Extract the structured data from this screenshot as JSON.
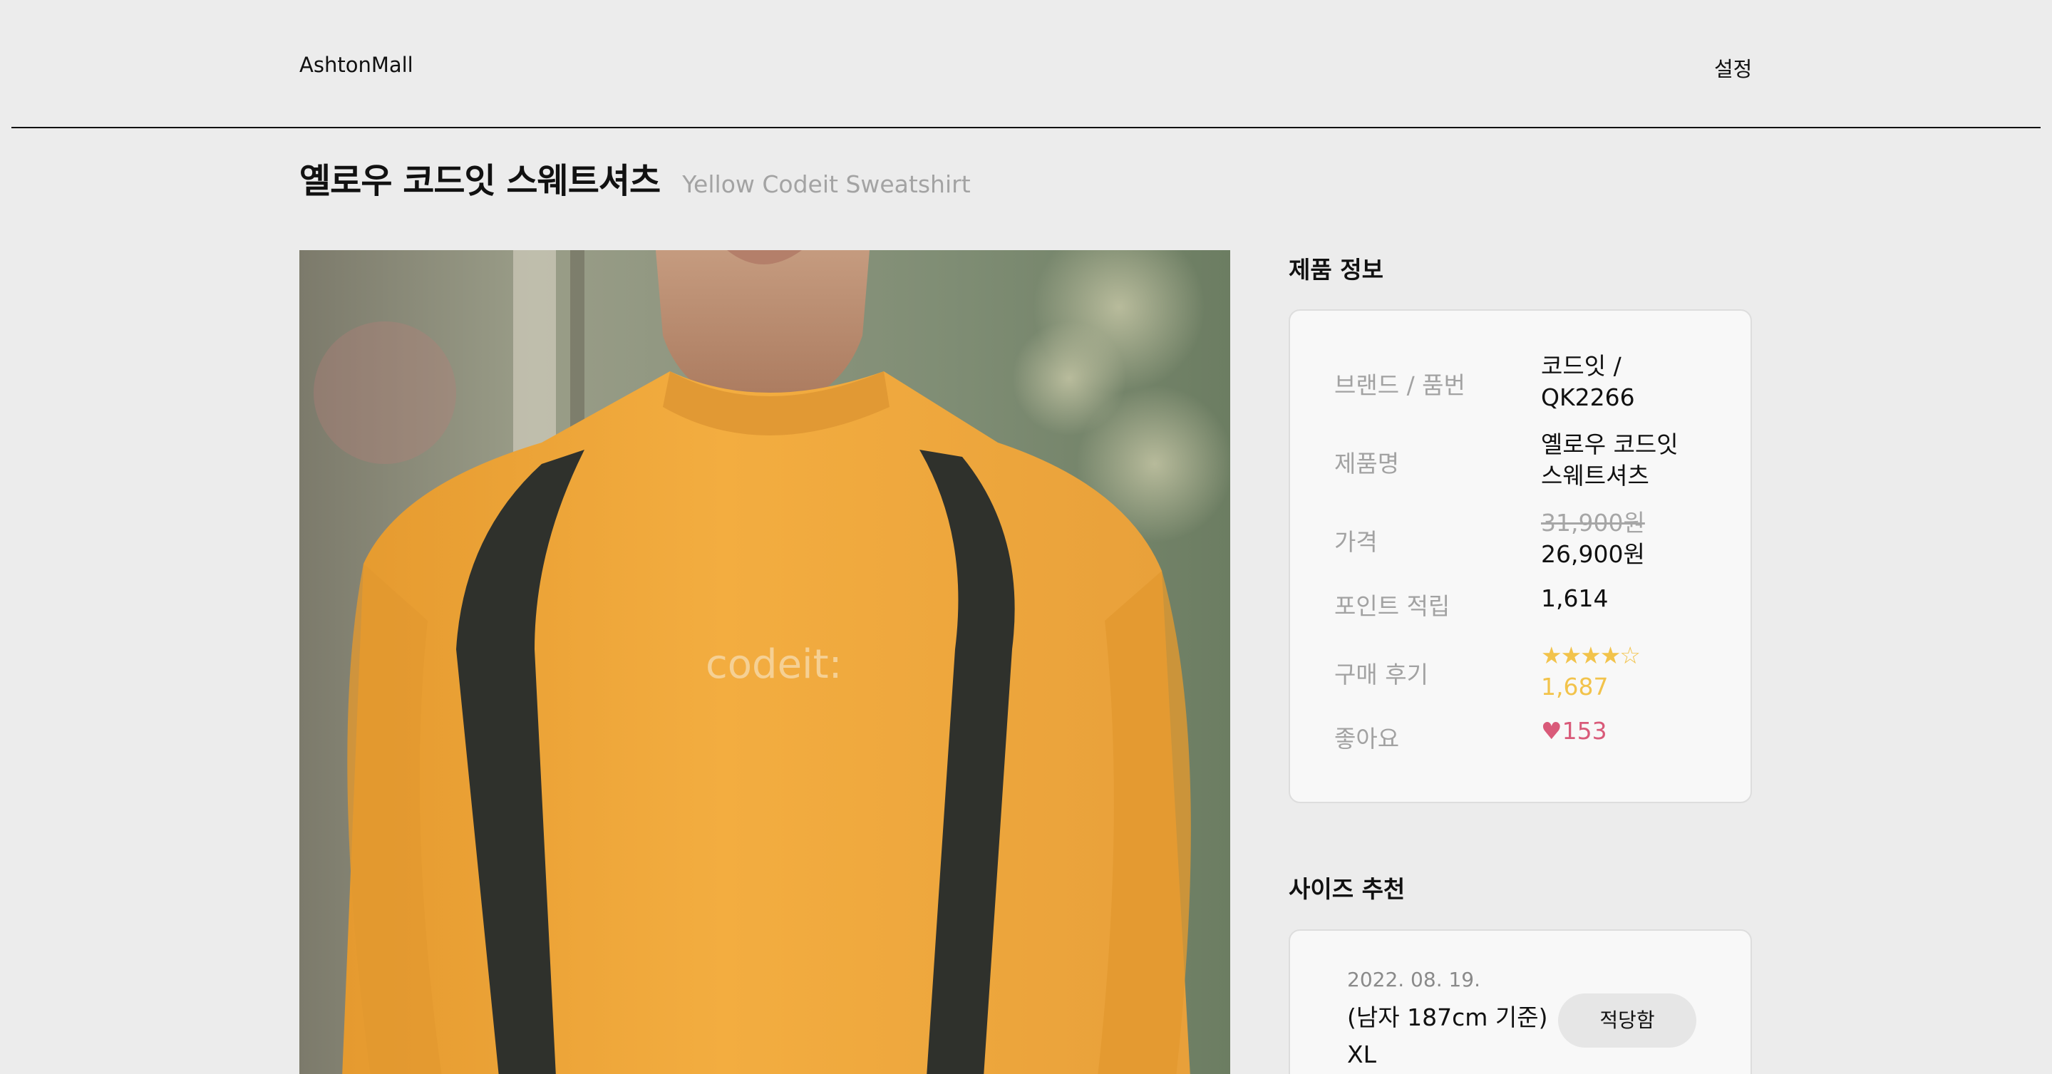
{
  "header": {
    "logo": "AshtonMall",
    "settings_label": "설정"
  },
  "product": {
    "title_ko": "옐로우 코드잇 스웨트셔츠",
    "title_en": "Yellow Codeit Sweatshirt",
    "image_print_text": "codeit:"
  },
  "info": {
    "section_title": "제품 정보",
    "rows": [
      {
        "label": "브랜드 / 품번",
        "value_line1": "코드잇 /",
        "value_line2": "QK2266"
      },
      {
        "label": "제품명",
        "value_line1": "옐로우 코드잇",
        "value_line2": "스웨트셔츠"
      },
      {
        "label": "가격",
        "original_price": "31,900원",
        "sale_price": "26,900원"
      },
      {
        "label": "포인트 적립",
        "value": "1,614"
      },
      {
        "label": "구매 후기",
        "stars": "★★★★☆",
        "count": "1,687"
      },
      {
        "label": "좋아요",
        "likes": "♥153"
      }
    ]
  },
  "size": {
    "section_title": "사이즈 추천",
    "date": "2022. 08. 19.",
    "body_line1": "(남자 187cm 기준)",
    "body_line2": "XL",
    "fit_label": "적당함"
  },
  "colors": {
    "background": "#ececec",
    "card": "#f8f8f8",
    "star": "#f2c34b",
    "heart": "#d95a79",
    "sweatshirt": "#f0a93c"
  }
}
